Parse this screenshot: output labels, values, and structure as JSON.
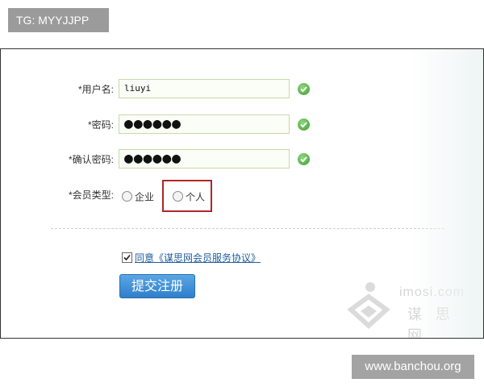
{
  "overlay": {
    "top_tag": "TG: MYYJJPP",
    "bottom_tag": "www.banchou.org"
  },
  "form": {
    "username": {
      "star": "*",
      "label": "用户名:",
      "value": "liuyi"
    },
    "password": {
      "star": "*",
      "label": "密码:",
      "value": "●●●●●●"
    },
    "confirm_password": {
      "star": "*",
      "label": "确认密码:",
      "value": "●●●●●●"
    },
    "member_type": {
      "star": "*",
      "label": "会员类型:",
      "options": [
        "企业",
        "个人"
      ]
    },
    "agreement_text": "同意《谋思网会员服务协议》",
    "submit_label": "提交注册"
  },
  "watermark": {
    "domain": "imosi.com",
    "name": "谋 思 网"
  },
  "colors": {
    "submit_bg": "#3a8ad6",
    "highlight_border": "#b0262c",
    "valid_icon": "#3c9a2f"
  }
}
